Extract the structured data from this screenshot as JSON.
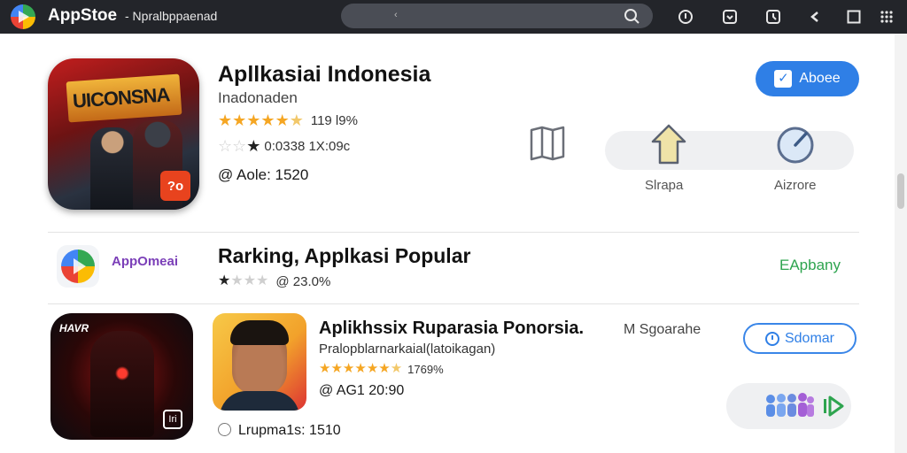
{
  "header": {
    "app_name": "AppStoe",
    "subtitle": "- Npralbppaenad",
    "search": {
      "cursor": "‹"
    }
  },
  "featured": {
    "icon_banner": "UICONSNA",
    "icon_badge": "?o",
    "title": "Apllkasiai Indonesia",
    "developer": "Inadonaden",
    "rating_1": "119 l9%",
    "rating_2": "0:0338  1X:09c",
    "age": "@ Aole: 1520",
    "primary_button": "Aboee",
    "action_share": "Slrapa",
    "action_gauge": "Aizrore"
  },
  "ranking": {
    "brand": "AppOmeai",
    "title": "Rarking, Applkasi Popular",
    "link": "EApbany",
    "rating": "@ 23.0%"
  },
  "list_item": {
    "hero_label": "HAVR",
    "hero_badge": "Iri",
    "title": "Aplikhssix Ruparasia Ponorsia.",
    "subtitle": "Pralopblarnarkaial(latoikagan)",
    "rating": "1769%",
    "age": "@ AG1 20:90",
    "meta": "M Sgoarahe",
    "button": "Sdomar",
    "footer": "Lrupma1s: 1510"
  },
  "colors": {
    "topbar": "#23252a",
    "accent_blue": "#2f7fe6",
    "star": "#f5a623",
    "green_link": "#2ea44f",
    "brand_purple": "#7b3fb8"
  }
}
